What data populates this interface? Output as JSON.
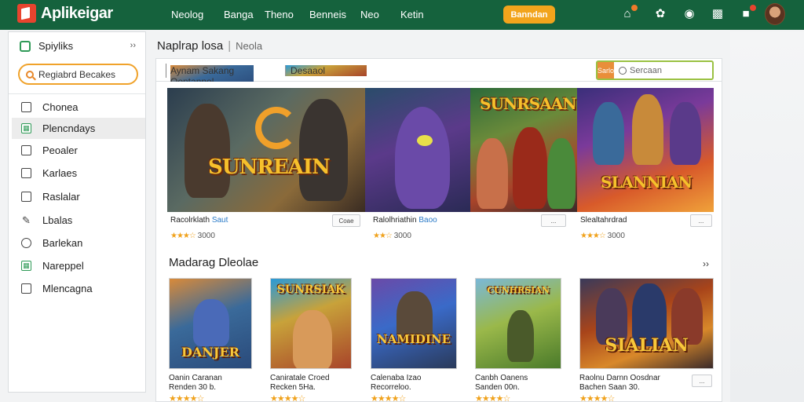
{
  "app": {
    "title": "Aplikeigar"
  },
  "nav": [
    "Neolog",
    "Banga",
    "Theno",
    "Benneis",
    "Neo",
    "Ketin"
  ],
  "cta_label": "Banndan",
  "top_icons": [
    "house-icon",
    "pin-icon",
    "bell-icon",
    "chat-icon",
    "flag-icon"
  ],
  "sidebar": {
    "heading": "Spiyliks",
    "collapse": "››",
    "search_label": "Regiabrd Becakes",
    "items": [
      {
        "label": "Chonea",
        "icon": "home-icon"
      },
      {
        "label": "Plencndays",
        "icon": "grid-icon"
      },
      {
        "label": "Peoaler",
        "icon": "file-icon"
      },
      {
        "label": "Karlaes",
        "icon": "lock-icon"
      },
      {
        "label": "Raslalar",
        "icon": "box-icon"
      },
      {
        "label": "Lbalas",
        "icon": "pencil-icon"
      },
      {
        "label": "Barlekan",
        "icon": "circle-icon"
      },
      {
        "label": "Nareppel",
        "icon": "grid-icon"
      },
      {
        "label": "Mlencagna",
        "icon": "list-icon"
      }
    ]
  },
  "main": {
    "breadcrumb": {
      "title": "Naplrap losa",
      "sub": "Neola"
    },
    "toolbar": {
      "text1": "Aynam Sakang Oontannol",
      "text2": "Desaaol"
    },
    "search": {
      "button": "Sarlo",
      "placeholder": "Sercaan"
    }
  },
  "featured": [
    {
      "title": "Racolrklath",
      "highlight": "Saut",
      "button": "Coae",
      "stars": "★★★☆",
      "rating": "3000",
      "art": "SUNREAIN"
    },
    {
      "title": "Ralolhriathin",
      "highlight": "Baoo",
      "button": "...",
      "stars": "★★☆",
      "rating": "3000",
      "art": ""
    },
    {
      "title": "Slealtahrdrad",
      "highlight": "",
      "button": "...",
      "stars": "★★★☆",
      "rating": "3000",
      "art": "SUNRSAAN"
    },
    {
      "art": "SLANNIAN"
    }
  ],
  "section": {
    "title": "Madarag Dleolae",
    "more": "››"
  },
  "tiles": [
    {
      "art": "DANJER",
      "line1": "Oanin Caranan",
      "line2": "Renden 30 b.",
      "stars": "★★★★☆"
    },
    {
      "art": "SUNRSIAK",
      "line1": "Caniratale Croed",
      "line2": "Recken 5Ha.",
      "stars": "★★★★☆"
    },
    {
      "art": "NAMIDINE",
      "line1": "Calenaba Izao",
      "line2": "Recorreloo.",
      "stars": "★★★★☆"
    },
    {
      "art": "CUNHRSIAN",
      "line1": "Canbh Oanens",
      "line2": "Sanden 00n.",
      "stars": "★★★★☆"
    },
    {
      "art": "SIALIAN",
      "line1": "Raolnu Darnn Oosdnar",
      "line2": "Bachen Saan 30.",
      "stars": "★★★★☆"
    }
  ],
  "tile_button": "...",
  "colors": {
    "topbar": "#15623d",
    "accent": "#f2a41c",
    "star": "#f0a21c"
  }
}
